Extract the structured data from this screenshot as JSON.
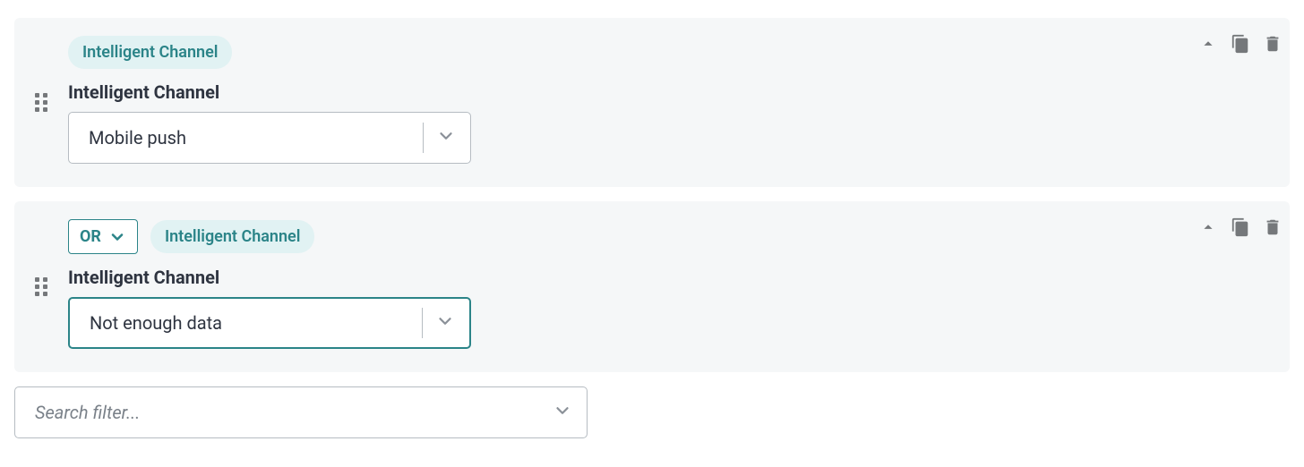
{
  "filters": [
    {
      "badge": "Intelligent Channel",
      "label": "Intelligent Channel",
      "value": "Mobile push",
      "operator": null,
      "active": false
    },
    {
      "badge": "Intelligent Channel",
      "label": "Intelligent Channel",
      "value": "Not enough data",
      "operator": "OR",
      "active": true
    }
  ],
  "search": {
    "placeholder": "Search filter..."
  }
}
